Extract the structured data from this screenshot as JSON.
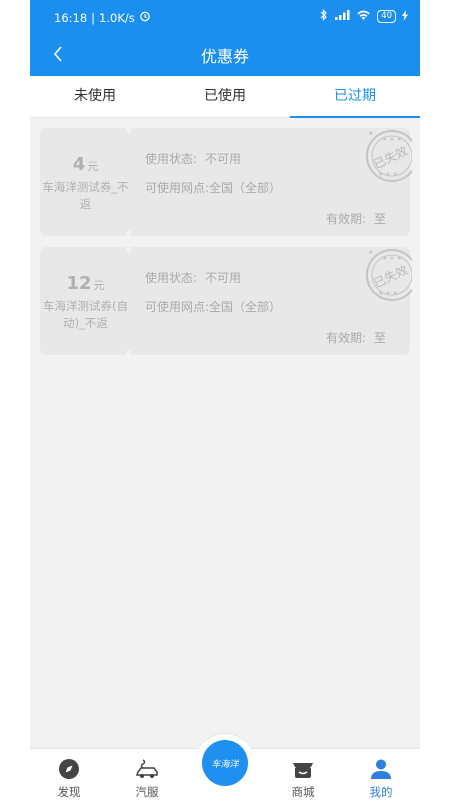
{
  "status": {
    "time": "16:18",
    "speed": "1.0K/s",
    "battery": "40"
  },
  "header": {
    "title": "优惠券"
  },
  "tabs": [
    {
      "label": "未使用"
    },
    {
      "label": "已使用"
    },
    {
      "label": "已过期"
    }
  ],
  "coupons": [
    {
      "amount": "4",
      "unit": "元",
      "name": "车海洋测试券_不返",
      "status_label": "使用状态:",
      "status_value": "不可用",
      "outlets_label": "可使用网点:",
      "outlets_value": "全国（全部）",
      "validity_label": "有效期:",
      "validity_value": "至",
      "stamp_text": "已失效"
    },
    {
      "amount": "12",
      "unit": "元",
      "name": "车海洋测试券(自动)_不返",
      "status_label": "使用状态:",
      "status_value": "不可用",
      "outlets_label": "可使用网点:",
      "outlets_value": "全国（全部）",
      "validity_label": "有效期:",
      "validity_value": "至",
      "stamp_text": "已失效"
    }
  ],
  "bottom_nav": [
    {
      "label": "发现",
      "icon": "compass-icon"
    },
    {
      "label": "汽服",
      "icon": "car-service-icon"
    },
    {
      "label": "车海洋",
      "icon": "brand-logo-icon"
    },
    {
      "label": "商城",
      "icon": "vip-shop-icon"
    },
    {
      "label": "我的",
      "icon": "person-icon"
    }
  ],
  "colors": {
    "primary": "#1a8ff0",
    "coupon_bg": "#e8e8e8",
    "muted_text": "#aaaaaa"
  }
}
